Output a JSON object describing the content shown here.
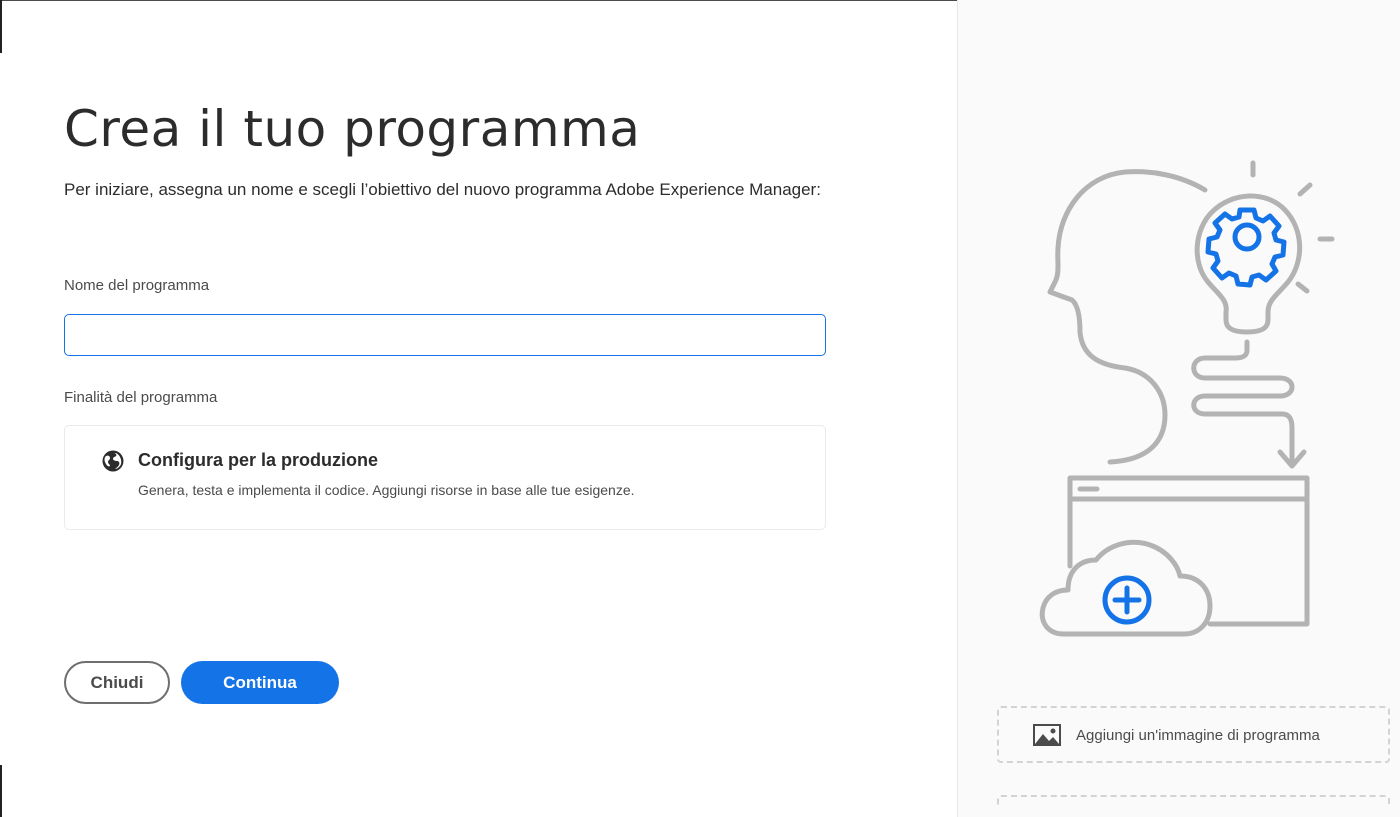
{
  "dialog": {
    "title": "Crea il tuo programma",
    "subtitle": "Per iniziare, assegna un nome e scegli l’obiettivo del nuovo programma Adobe Experience Manager:"
  },
  "form": {
    "name_label": "Nome del programma",
    "name_value": "",
    "name_placeholder": "",
    "purpose_label": "Finalità del programma",
    "purpose_option": {
      "icon": "globe-icon",
      "title": "Configura per la produzione",
      "description": "Genera, testa e implementa il codice. Aggiungi risorse in base alle tue esigenze."
    }
  },
  "buttons": {
    "close_label": "Chiudi",
    "continue_label": "Continua"
  },
  "sidebar": {
    "illustration_icons": [
      "head-icon",
      "lightbulb-icon",
      "gear-icon",
      "window-icon",
      "cloud-icon",
      "plus-icon"
    ],
    "add_image_icon": "image-icon",
    "add_image_label": "Aggiungi un'immagine di programma"
  },
  "colors": {
    "accent": "#1473e6",
    "illustration_gray": "#b3b3b3",
    "text": "#2c2c2c"
  }
}
